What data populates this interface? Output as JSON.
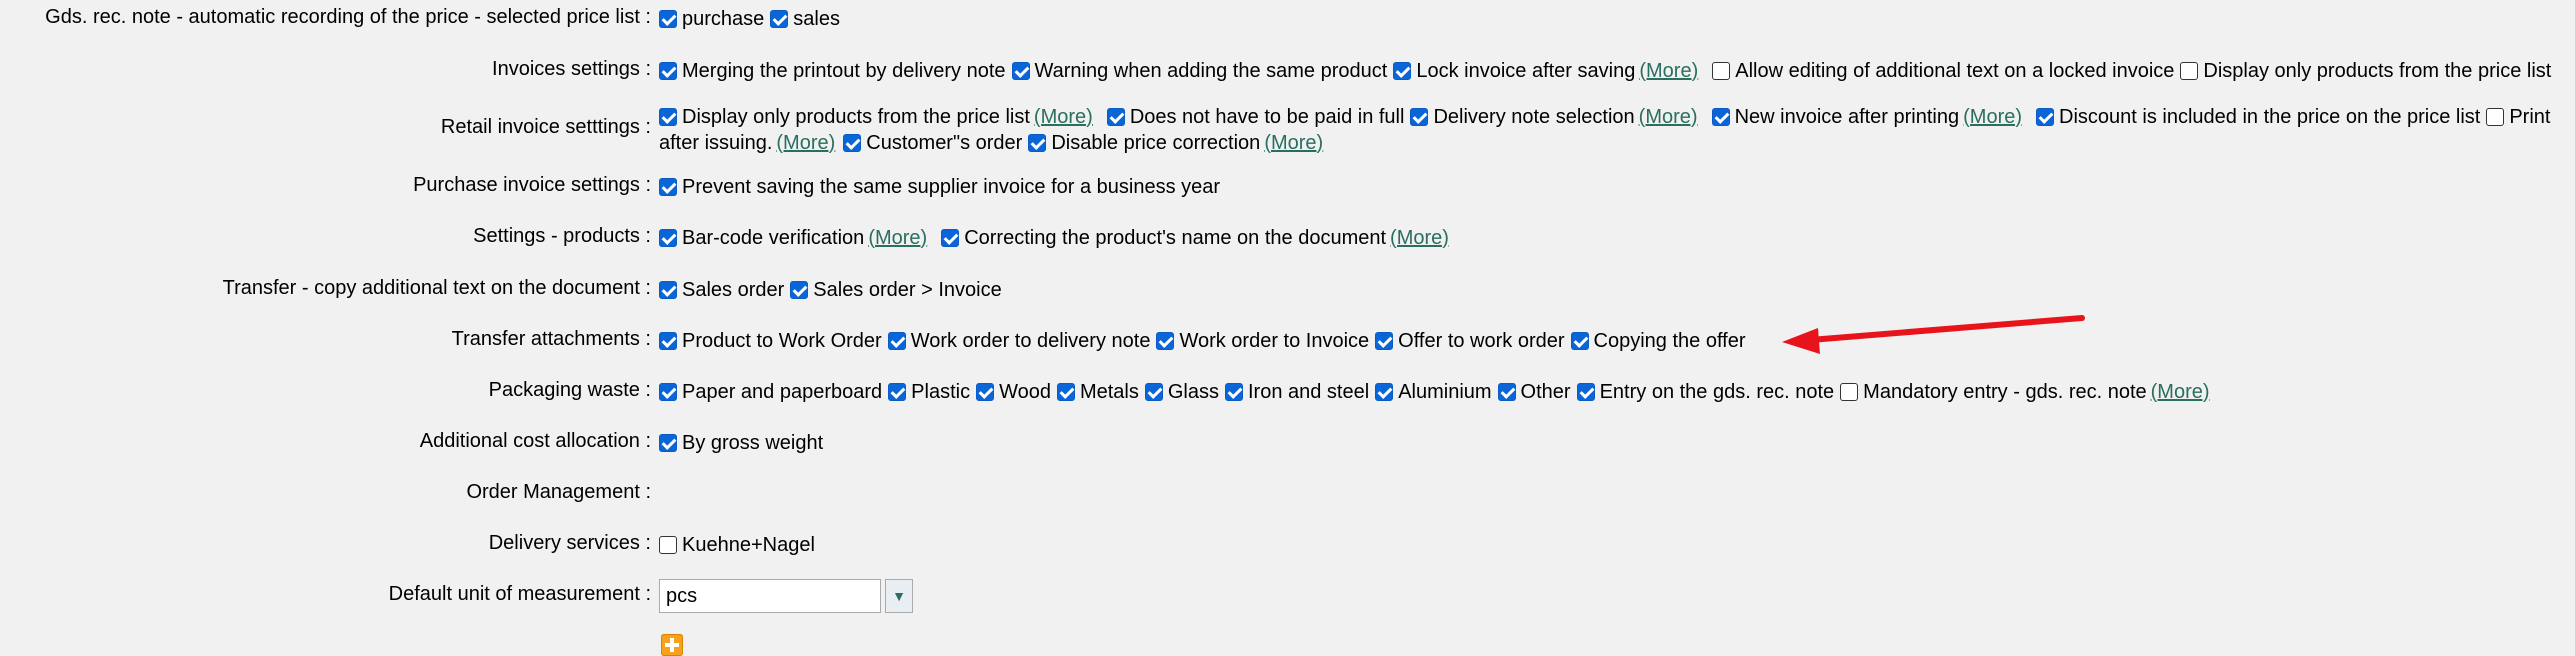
{
  "rows": {
    "gds": {
      "label": "Gds. rec. note - automatic recording of the price - selected price list :",
      "opt1": "purchase",
      "opt2": "sales"
    },
    "invoices": {
      "label": "Invoices settings :",
      "opt1": "Merging the printout by delivery note",
      "opt2": "Warning when adding the same product",
      "opt3": "Lock invoice after saving",
      "more": "(More)",
      "opt4": "Allow editing of additional text on a locked invoice",
      "opt5": "Display only products from the price list"
    },
    "retail": {
      "label": "Retail invoice setttings :",
      "opt1": "Display only products from the price list",
      "more1": "(More)",
      "opt2": "Does not have to be paid in full",
      "opt3": "Delivery note selection",
      "more2": "(More)",
      "opt4": "New invoice after printing",
      "more3": "(More)",
      "opt5": "Discount is included in the price on the price list",
      "opt6": "Print",
      "line2_text": "after issuing.",
      "more4": "(More)",
      "opt7": "Customer\"s order",
      "opt8": "Disable price correction",
      "more5": "(More)"
    },
    "purchase": {
      "label": "Purchase invoice settings :",
      "opt1": "Prevent saving the same supplier invoice for a business year"
    },
    "products": {
      "label": "Settings - products :",
      "opt1": "Bar-code verification",
      "more1": "(More)",
      "opt2": "Correcting the product's name on the document",
      "more2": "(More)"
    },
    "transfer_text": {
      "label": "Transfer - copy additional text on the document :",
      "opt1": "Sales order",
      "opt2": "Sales order > Invoice"
    },
    "transfer_att": {
      "label": "Transfer attachments :",
      "opt1": "Product to Work Order",
      "opt2": "Work order to delivery note",
      "opt3": "Work order to Invoice",
      "opt4": "Offer to work order",
      "opt5": "Copying the offer"
    },
    "packaging": {
      "label": "Packaging waste :",
      "opt1": "Paper and paperboard",
      "opt2": "Plastic",
      "opt3": "Wood",
      "opt4": "Metals",
      "opt5": "Glass",
      "opt6": "Iron and steel",
      "opt7": "Aluminium",
      "opt8": "Other",
      "opt9": "Entry on the gds. rec. note",
      "opt10": "Mandatory entry - gds. rec. note",
      "more": "(More)"
    },
    "cost": {
      "label": "Additional cost allocation :",
      "opt1": "By gross weight"
    },
    "order_mgmt": {
      "label": "Order Management :"
    },
    "delivery": {
      "label": "Delivery services :",
      "opt1": "Kuehne+Nagel"
    },
    "unit": {
      "label": "Default unit of measurement :",
      "value": "pcs"
    }
  },
  "colors": {
    "checkbox": "#0a66d8",
    "link": "#2a6e5f",
    "arrow": "#e8141b",
    "add_icon": "#f7a21b"
  },
  "icons": {
    "dropdown": "chevron-down-icon",
    "add": "add-icon",
    "annotation": "arrow-annotation"
  }
}
